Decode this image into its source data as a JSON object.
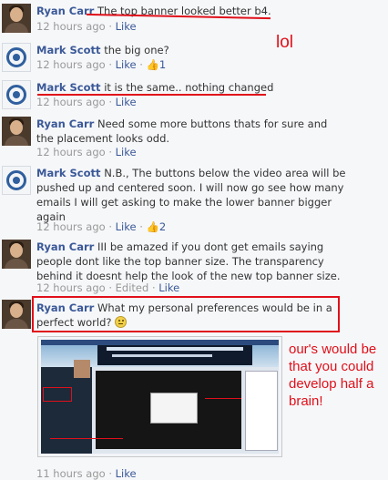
{
  "comments": [
    {
      "author": "Ryan Carr",
      "text": "The top banner looked better b4.",
      "time": "12 hours ago",
      "like": "Like",
      "avatar": "person-photo"
    },
    {
      "author": "Mark Scott",
      "text": "the big one?",
      "time": "12 hours ago",
      "like": "Like",
      "likes": "1",
      "avatar": "channel-logo"
    },
    {
      "author": "Mark Scott",
      "text": "it is the same.. nothing changed",
      "time": "12 hours ago",
      "like": "Like",
      "avatar": "channel-logo"
    },
    {
      "author": "Ryan Carr",
      "text": "Need some more buttons thats for sure and the placement looks odd.",
      "time": "12 hours ago",
      "like": "Like",
      "avatar": "person-photo"
    },
    {
      "author": "Mark Scott",
      "text": "N.B., The buttons below the video area will be pushed up and centered soon. I will now go see how many emails I will get asking to make the lower banner bigger again",
      "time": "12 hours ago",
      "like": "Like",
      "likes": "2",
      "avatar": "channel-logo"
    },
    {
      "author": "Ryan Carr",
      "text": "III be amazed if you dont get emails saying people dont like the top banner size. The transparency behind it doesnt help the look of the new top banner size.",
      "time": "12 hours ago",
      "edited": "Edited",
      "like": "Like",
      "avatar": "person-photo"
    },
    {
      "author": "Ryan Carr",
      "text": "What my personal preferences would be in a perfect world?",
      "time": "11 hours ago",
      "like": "Like",
      "avatar": "person-photo"
    }
  ],
  "separator": "·",
  "annotations": {
    "lol": "lol",
    "side_note": "our's would be that you could develop half a brain!"
  },
  "colors": {
    "author_link": "#3b5998",
    "meta_gray": "#999999",
    "annotation_red": "#e0101a"
  }
}
